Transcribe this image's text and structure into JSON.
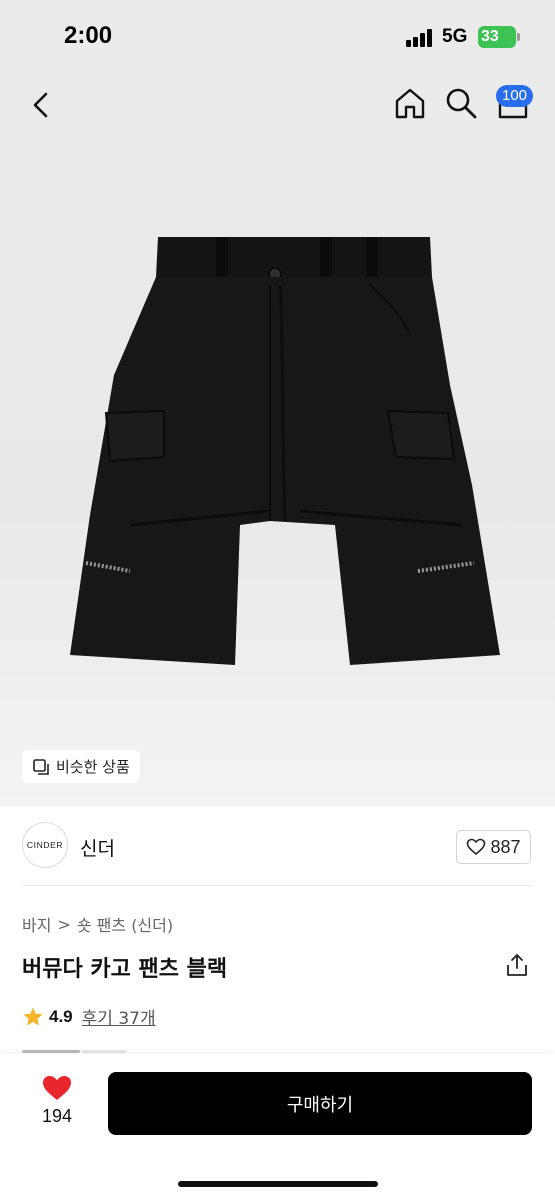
{
  "status_bar": {
    "time": "2:00",
    "network": "5G",
    "battery": "33"
  },
  "nav": {
    "back_icon": "chevron-left-icon",
    "home_icon": "home-icon",
    "search_icon": "search-icon",
    "cart_icon": "cart-icon",
    "cart_badge": "100"
  },
  "product_image": {
    "similar_label": "비슷한 상품"
  },
  "shop": {
    "logo_text": "CINDER",
    "name": "신더",
    "likes": "887"
  },
  "breadcrumb": {
    "items": [
      "바지",
      "숏 팬츠 (신더)"
    ],
    "separator": ">"
  },
  "product": {
    "title": "버뮤다 카고 팬츠 블랙",
    "rating": "4.9",
    "reviews": "후기 37개"
  },
  "bottom_bar": {
    "wish_count": "194",
    "buy_label": "구매하기"
  },
  "colors": {
    "accent_badge": "#2a6ef0",
    "heart": "#e8262c",
    "star": "#f7b52c",
    "buy_button": "#000000",
    "battery": "#3dc254"
  }
}
